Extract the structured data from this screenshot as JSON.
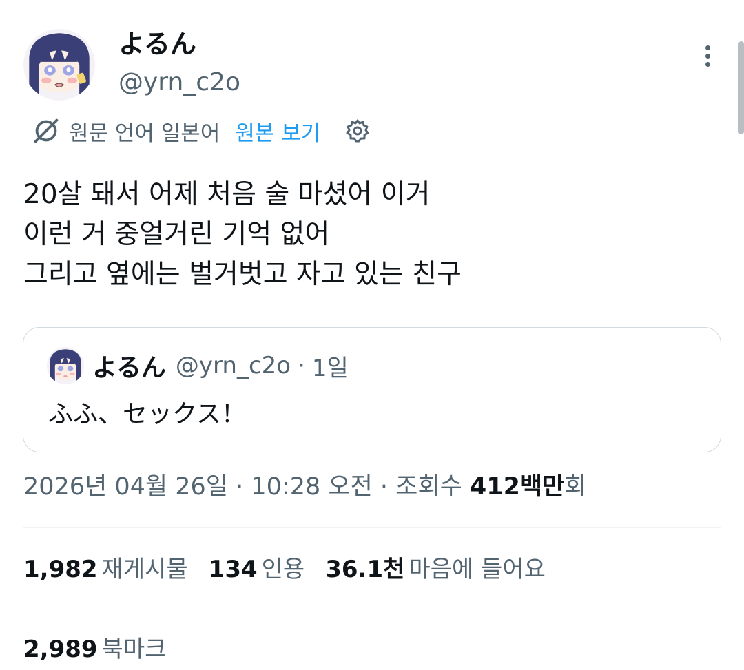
{
  "tweet": {
    "display_name": "よるん",
    "handle": "@yrn_c2o",
    "translation": {
      "label": "원문 언어 일본어",
      "link": "원본 보기",
      "icon": "translate-icon",
      "settings_icon": "gear-icon"
    },
    "text_lines": [
      "20살 돼서 어제 처음 술 마셨어 이거",
      "이런 거 중얼거린 기억 없어",
      "그리고 옆에는 벌거벗고 자고 있는 친구"
    ],
    "quoted": {
      "display_name": "よるん",
      "handle": "@yrn_c2o",
      "separator": "·",
      "time": "1일",
      "text": "ふふ、セックス！"
    },
    "meta": {
      "date": "2026년 04월 26일",
      "sep1": " · ",
      "time": "10:28 오전",
      "sep2": " · ",
      "views_label": "조회수 ",
      "views_number": "412백만",
      "views_suffix": "회"
    },
    "stats": {
      "retweets_count": "1,982",
      "retweets_label": "재게시물",
      "quotes_count": "134",
      "quotes_label": "인용",
      "likes_count": "36.1천",
      "likes_label": "마음에 들어요",
      "bookmarks_count": "2,989",
      "bookmarks_label": "북마크"
    },
    "colors": {
      "accent": "#1d9bf0",
      "secondary_text": "#536471",
      "primary_text": "#0f1419",
      "border": "#cfd9de"
    }
  }
}
